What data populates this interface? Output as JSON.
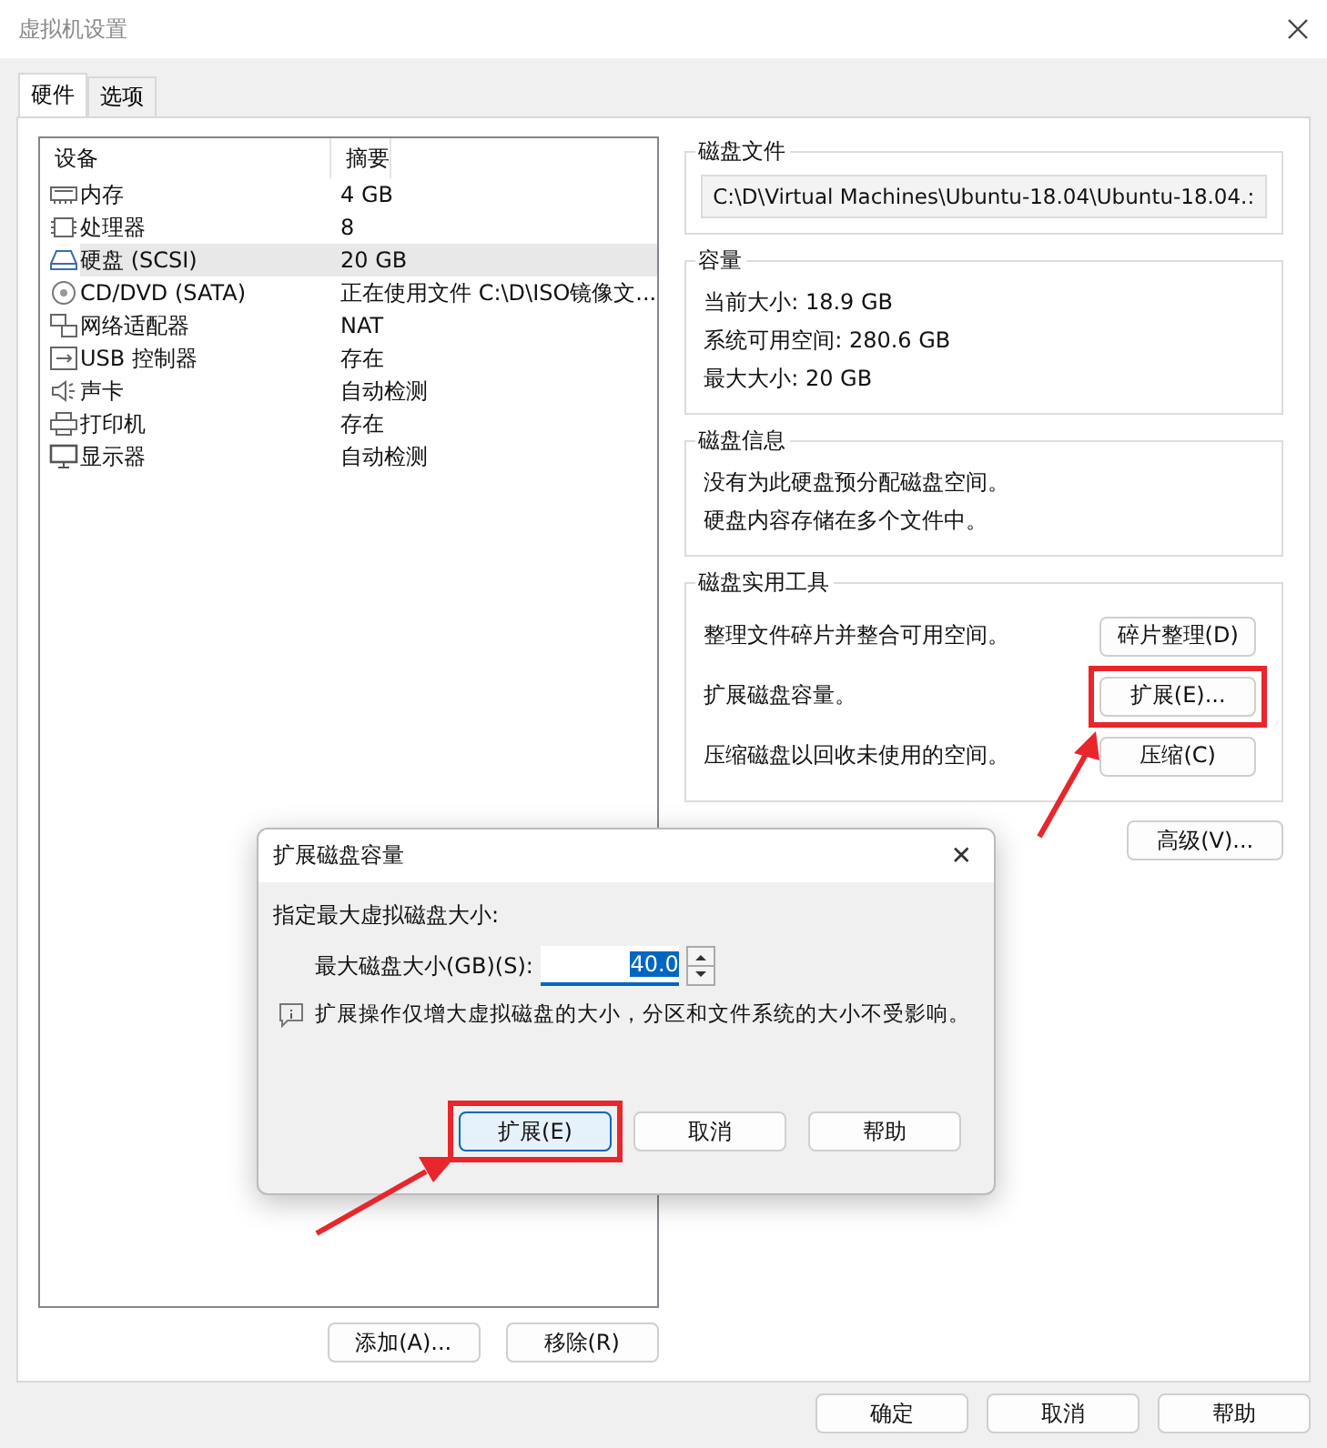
{
  "window": {
    "title": "虚拟机设置"
  },
  "tabs": [
    {
      "label": "硬件",
      "selected": true
    },
    {
      "label": "选项",
      "selected": false
    }
  ],
  "device_table": {
    "columns": [
      "设备",
      "摘要"
    ],
    "rows": [
      {
        "device": "内存",
        "summary": "4 GB",
        "selected": false
      },
      {
        "device": "处理器",
        "summary": "8",
        "selected": false
      },
      {
        "device": "硬盘 (SCSI)",
        "summary": "20 GB",
        "selected": true
      },
      {
        "device": "CD/DVD (SATA)",
        "summary": "正在使用文件 C:\\D\\ISO镜像文...",
        "selected": false
      },
      {
        "device": "网络适配器",
        "summary": "NAT",
        "selected": false
      },
      {
        "device": "USB 控制器",
        "summary": "存在",
        "selected": false
      },
      {
        "device": "声卡",
        "summary": "自动检测",
        "selected": false
      },
      {
        "device": "打印机",
        "summary": "存在",
        "selected": false
      },
      {
        "device": "显示器",
        "summary": "自动检测",
        "selected": false
      }
    ]
  },
  "list_buttons": [
    "添加(A)...",
    "移除(R)"
  ],
  "disk_file": {
    "title": "磁盘文件",
    "value": "C:\\D\\Virtual Machines\\Ubuntu-18.04\\Ubuntu-18.04.:"
  },
  "capacity": {
    "title": "容量",
    "lines": [
      "当前大小: 18.9 GB",
      "系统可用空间: 280.6 GB",
      "最大大小: 20 GB"
    ]
  },
  "disk_info": {
    "title": "磁盘信息",
    "lines": [
      "没有为此硬盘预分配磁盘空间。",
      "硬盘内容存储在多个文件中。"
    ]
  },
  "utilities": {
    "title": "磁盘实用工具",
    "rows": [
      {
        "text": "整理文件碎片并整合可用空间。",
        "button": "碎片整理(D)",
        "highlighted": false
      },
      {
        "text": "扩展磁盘容量。",
        "button": "扩展(E)...",
        "highlighted": true
      },
      {
        "text": "压缩磁盘以回收未使用的空间。",
        "button": "压缩(C)",
        "highlighted": false
      }
    ]
  },
  "advanced_button": "高级(V)...",
  "footer_buttons": [
    "确定",
    "取消",
    "帮助"
  ],
  "dialog": {
    "title": "扩展磁盘容量",
    "close": "✕",
    "prompt": "指定最大虚拟磁盘大小:",
    "field_label": "最大磁盘大小(GB)(S):",
    "field_value": "40.0",
    "note": "扩展操作仅增大虚拟磁盘的大小，分区和文件系统的大小不受影响。",
    "buttons": [
      {
        "label": "扩展(E)",
        "highlighted": true
      },
      {
        "label": "取消",
        "highlighted": false
      },
      {
        "label": "帮助",
        "highlighted": false
      }
    ]
  }
}
